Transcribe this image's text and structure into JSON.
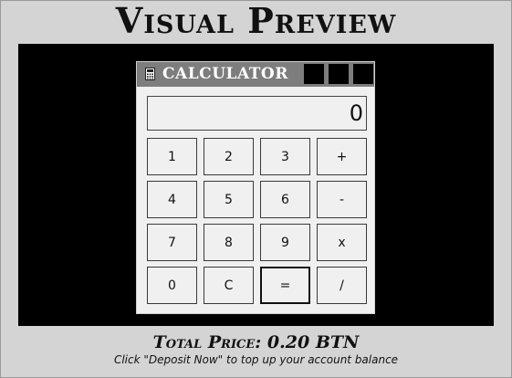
{
  "page": {
    "heading": "Visual Preview"
  },
  "calculator": {
    "title": "CALCULATOR",
    "icon": "calculator-icon",
    "window_buttons": [
      "minimize",
      "maximize",
      "close"
    ],
    "display_value": "0",
    "keys": [
      {
        "label": "1",
        "id": "key-1"
      },
      {
        "label": "2",
        "id": "key-2"
      },
      {
        "label": "3",
        "id": "key-3"
      },
      {
        "label": "+",
        "id": "key-plus"
      },
      {
        "label": "4",
        "id": "key-4"
      },
      {
        "label": "5",
        "id": "key-5"
      },
      {
        "label": "6",
        "id": "key-6"
      },
      {
        "label": "-",
        "id": "key-minus"
      },
      {
        "label": "7",
        "id": "key-7"
      },
      {
        "label": "8",
        "id": "key-8"
      },
      {
        "label": "9",
        "id": "key-9"
      },
      {
        "label": "x",
        "id": "key-multiply"
      },
      {
        "label": "0",
        "id": "key-0"
      },
      {
        "label": "C",
        "id": "key-clear"
      },
      {
        "label": "=",
        "id": "key-equals"
      },
      {
        "label": "/",
        "id": "key-divide"
      }
    ]
  },
  "footer": {
    "price": "Total Price: 0.20 BTN",
    "hint": "Click \"Deposit Now\" to top up your account balance"
  }
}
